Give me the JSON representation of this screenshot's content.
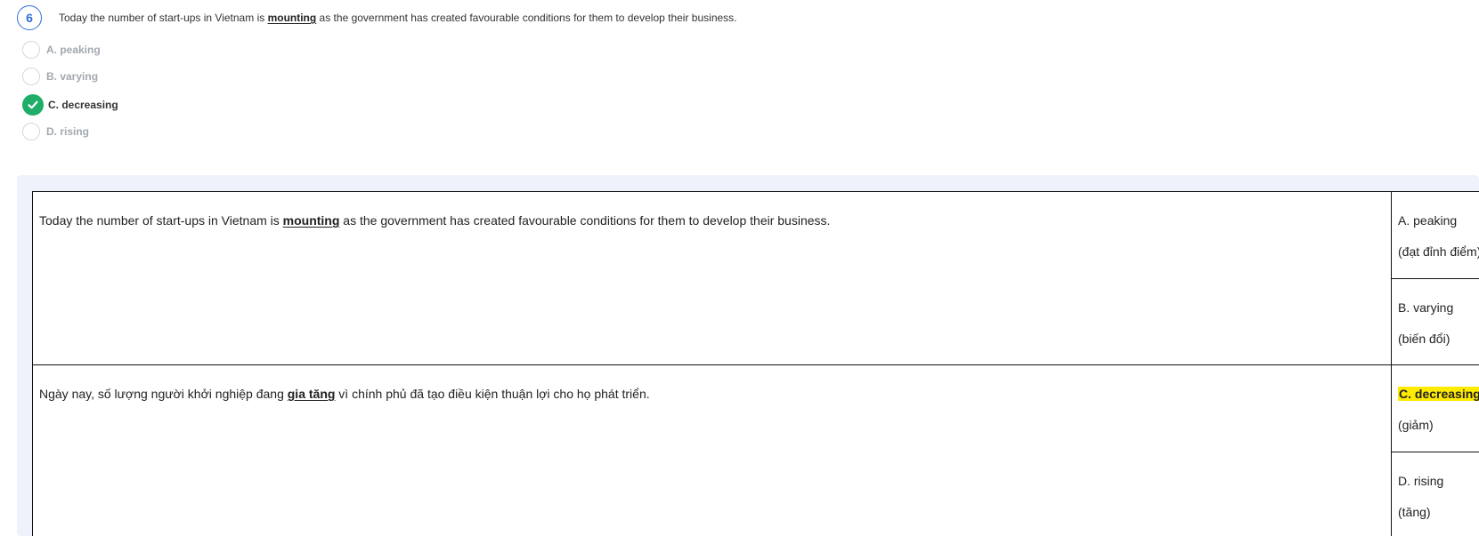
{
  "question": {
    "number": "6",
    "text_before": "Today the number of start-ups in Vietnam is ",
    "keyword": "mounting",
    "text_after": " as the government has created favourable conditions for them to develop their business."
  },
  "options": [
    {
      "label": "A. peaking",
      "selected": false
    },
    {
      "label": "B. varying",
      "selected": false
    },
    {
      "label": "C. decreasing",
      "selected": true
    },
    {
      "label": "D. rising",
      "selected": false
    }
  ],
  "explanation": {
    "english": {
      "before": "Today the number of start-ups in Vietnam is ",
      "keyword": "mounting",
      "after": " as the government has created favourable conditions for them to develop their business."
    },
    "vietnamese": {
      "before": "Ngày nay, số lượng người khởi nghiệp đang ",
      "keyword": "gia tăng",
      "after": " vì chính phủ đã tạo điều kiện thuận lợi cho họ phát triển."
    },
    "choices": [
      {
        "label": "A. peaking",
        "translation": "(đạt đỉnh điểm)"
      },
      {
        "label": "B. varying",
        "translation": "(biến đổi)"
      },
      {
        "label": "C. decreasing",
        "translation": "(giảm)"
      },
      {
        "label": "D. rising",
        "translation": "(tăng)"
      }
    ]
  },
  "colors": {
    "accent": "#2f6fd6",
    "correct": "#1fad68",
    "highlight": "#ffeb00",
    "panel_bg": "#eef3fb"
  }
}
